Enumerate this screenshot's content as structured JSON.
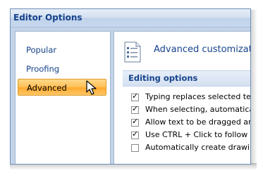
{
  "window": {
    "title": "Editor Options"
  },
  "nav": {
    "items": [
      {
        "label": "Popular",
        "selected": false
      },
      {
        "label": "Proofing",
        "selected": false
      },
      {
        "label": "Advanced",
        "selected": true
      }
    ]
  },
  "content": {
    "header": "Advanced customization",
    "section": "Editing options",
    "options": [
      {
        "label": "Typing replaces selected text",
        "checked": true
      },
      {
        "label": "When selecting, automatically",
        "checked": true
      },
      {
        "label": "Allow text to be dragged and",
        "checked": true
      },
      {
        "label": "Use CTRL + Click to follow hyp",
        "checked": true
      },
      {
        "label": "Automatically create drawing",
        "checked": false
      }
    ]
  },
  "colors": {
    "accent": "#15428b",
    "selection": "#ffc35c",
    "chrome": "#c4d4e8"
  },
  "icons": {
    "header": "document-list-icon",
    "cursor": "mouse-pointer-icon",
    "check": "check-mark-icon"
  }
}
